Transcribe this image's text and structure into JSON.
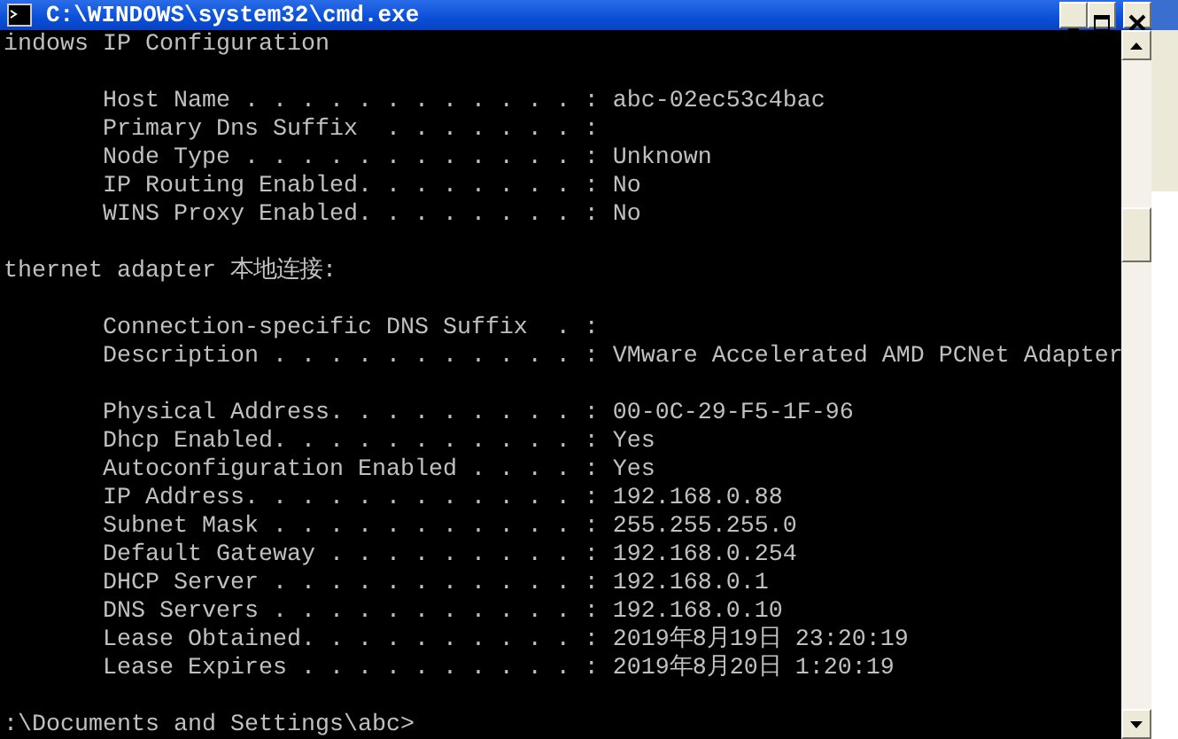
{
  "window": {
    "title": "C:\\WINDOWS\\system32\\cmd.exe"
  },
  "console": {
    "blocks": [
      {
        "lines": [
          "indows IP Configuration"
        ]
      },
      {
        "lines": [
          "       Host Name . . . . . . . . . . . . : abc-02ec53c4bac",
          "       Primary Dns Suffix  . . . . . . . : ",
          "       Node Type . . . . . . . . . . . . : Unknown",
          "       IP Routing Enabled. . . . . . . . : No",
          "       WINS Proxy Enabled. . . . . . . . : No"
        ]
      },
      {
        "lines": [
          "thernet adapter 本地连接:"
        ]
      },
      {
        "lines": [
          "       Connection-specific DNS Suffix  . : ",
          "       Description . . . . . . . . . . . : VMware Accelerated AMD PCNet Adapter"
        ]
      },
      {
        "lines": [
          "       Physical Address. . . . . . . . . : 00-0C-29-F5-1F-96",
          "       Dhcp Enabled. . . . . . . . . . . : Yes",
          "       Autoconfiguration Enabled . . . . : Yes",
          "       IP Address. . . . . . . . . . . . : 192.168.0.88",
          "       Subnet Mask . . . . . . . . . . . : 255.255.255.0",
          "       Default Gateway . . . . . . . . . : 192.168.0.254",
          "       DHCP Server . . . . . . . . . . . : 192.168.0.1",
          "       DNS Servers . . . . . . . . . . . : 192.168.0.10",
          "       Lease Obtained. . . . . . . . . . : 2019年8月19日 23:20:19",
          "       Lease Expires . . . . . . . . . . : 2019年8月20日 1:20:19"
        ]
      },
      {
        "lines": [
          ":\\Documents and Settings\\abc>"
        ]
      }
    ]
  }
}
